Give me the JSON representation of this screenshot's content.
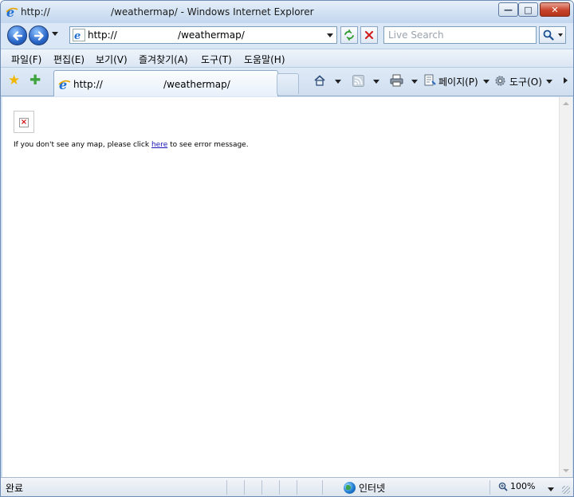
{
  "window": {
    "title": "http://                    /weathermap/ - Windows Internet Explorer",
    "caption": {
      "minimize": "—",
      "maximize": "□",
      "close": "✕"
    }
  },
  "navbar": {
    "address": "http://                    /weathermap/",
    "search_placeholder": "Live Search"
  },
  "menu": {
    "items": [
      "파일(F)",
      "편집(E)",
      "보기(V)",
      "즐겨찾기(A)",
      "도구(T)",
      "도움말(H)"
    ]
  },
  "tab": {
    "title": "http://                    /weathermap/"
  },
  "commandbar": {
    "page_label": "페이지(P)",
    "tools_label": "도구(O)"
  },
  "content": {
    "message_before": "If you don't see any map, please click ",
    "link_text": "here",
    "message_after": " to see error message."
  },
  "status": {
    "text": "완료",
    "zone": "인터넷",
    "zoom": "100%"
  },
  "colors": {
    "link": "#1a16b5",
    "frame": "#6f8db5",
    "close_button": "#c8442a"
  },
  "icons": [
    "ie-icon",
    "back-arrow-icon",
    "forward-arrow-icon",
    "refresh-icon",
    "stop-icon",
    "search-icon",
    "favorites-star-icon",
    "add-favorites-icon",
    "home-icon",
    "feeds-icon",
    "print-icon",
    "page-icon",
    "gear-icon",
    "globe-icon",
    "zoom-icon",
    "broken-image-icon"
  ]
}
